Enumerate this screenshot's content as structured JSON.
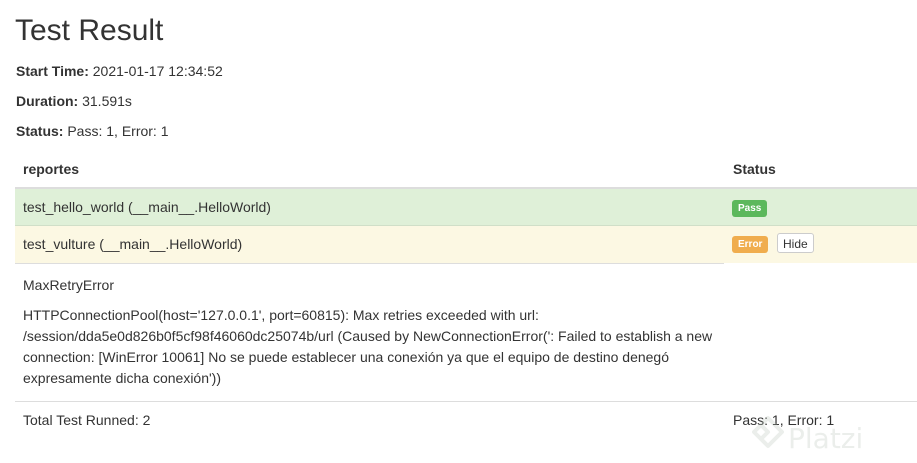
{
  "report": {
    "title": "Test Result",
    "start_time_label": "Start Time:",
    "start_time_value": "2021-01-17 12:34:52",
    "duration_label": "Duration:",
    "duration_value": "31.591s",
    "status_label": "Status:",
    "status_value": "Pass: 1, Error: 1"
  },
  "table": {
    "headers": {
      "name": "reportes",
      "status": "Status"
    },
    "rows": [
      {
        "name": "test_hello_world (__main__.HelloWorld)",
        "status": "Pass",
        "color": "#5cb85c",
        "row_bg": "#dff0d8"
      },
      {
        "name": "test_vulture (__main__.HelloWorld)",
        "status": "Error",
        "color": "#f0ad4e",
        "row_bg": "#fcf8e3",
        "toggle_label": "Hide"
      }
    ],
    "error_detail": {
      "name": "MaxRetryError",
      "message": "HTTPConnectionPool(host='127.0.0.1', port=60815): Max retries exceeded with url: /session/dda5e0d826b0f5cf98f46060dc25074b/url (Caused by NewConnectionError(': Failed to establish a new connection: [WinError 10061] No se puede establecer una conexión ya que el equipo de destino denegó expresamente dicha conexión'))"
    },
    "footer": {
      "total": "Total Test Runned: 2",
      "summary": "Pass: 1, Error: 1"
    }
  },
  "watermark": {
    "text": "Platzi",
    "icon": "platzi-logo-icon"
  }
}
